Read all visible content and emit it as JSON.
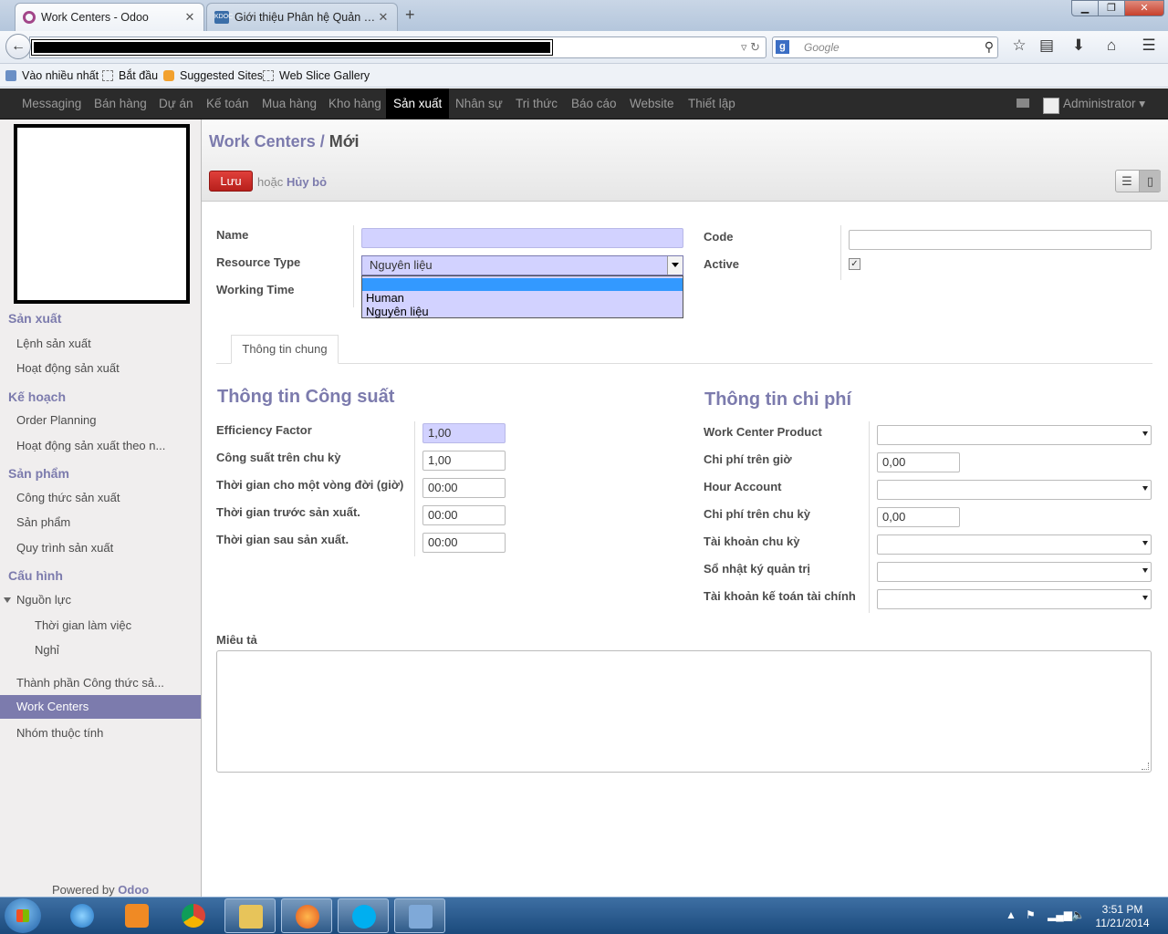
{
  "browser": {
    "tabs": [
      {
        "label": "Work Centers - Odoo",
        "active": true
      },
      {
        "label": "Giới thiệu Phân hệ Quản lý...",
        "active": false
      }
    ],
    "search_placeholder": "Google",
    "bookmarks": [
      "Vào nhiều nhất",
      "Bắt đầu",
      "Suggested Sites",
      "Web Slice Gallery"
    ]
  },
  "topmenu": {
    "items": [
      "Messaging",
      "Bán hàng",
      "Dự án",
      "Kế toán",
      "Mua hàng",
      "Kho hàng",
      "Sản xuất",
      "Nhân sự",
      "Tri thức",
      "Báo cáo",
      "Website",
      "Thiết lập"
    ],
    "active_index": 6,
    "user": "Administrator"
  },
  "sidebar": {
    "sections": [
      {
        "title": "Sản xuất",
        "items": [
          "Lệnh sản xuất",
          "Hoạt động sản xuất"
        ]
      },
      {
        "title": "Kế hoạch",
        "items": [
          "Order Planning",
          "Hoạt động sản xuất theo n..."
        ]
      },
      {
        "title": "Sản phẩm",
        "items": [
          "Công thức sản xuất",
          "Sản phẩm",
          "Quy trình sản xuất"
        ]
      },
      {
        "title": "Cấu hình",
        "items": [
          "Nguồn lực",
          "Thời gian làm việc",
          "Nghỉ",
          "Thành phần Công thức sả...",
          "Work Centers",
          "Nhóm thuộc tính"
        ]
      }
    ],
    "selected": "Work Centers",
    "powered_by": "Powered by",
    "powered_brand": "Odoo"
  },
  "header": {
    "breadcrumb_link": "Work Centers",
    "breadcrumb_sep": "/",
    "breadcrumb_current": "Mới",
    "save_label": "Lưu",
    "or_label": "hoặc",
    "discard_label": "Hủy bỏ"
  },
  "form": {
    "name_label": "Name",
    "name_value": "",
    "resource_type_label": "Resource Type",
    "resource_type_value": "Nguyên liệu",
    "resource_type_options": [
      "",
      "Human",
      "Nguyên liệu"
    ],
    "working_time_label": "Working Time",
    "code_label": "Code",
    "code_value": "",
    "active_label": "Active",
    "active_checked": true,
    "tab_label": "Thông tin chung",
    "capacity": {
      "title": "Thông tin Công suất",
      "rows": [
        {
          "label": "Efficiency Factor",
          "value": "1,00",
          "required": true
        },
        {
          "label": "Công suất trên chu kỳ",
          "value": "1,00"
        },
        {
          "label": "Thời gian cho một vòng đời (giờ)",
          "value": "00:00"
        },
        {
          "label": "Thời gian trước sản xuất.",
          "value": "00:00"
        },
        {
          "label": "Thời gian sau sản xuất.",
          "value": "00:00"
        }
      ]
    },
    "costing": {
      "title": "Thông tin chi phí",
      "rows": [
        {
          "label": "Work Center Product",
          "value": "",
          "type": "select"
        },
        {
          "label": "Chi phí trên giờ",
          "value": "0,00",
          "type": "input"
        },
        {
          "label": "Hour Account",
          "value": "",
          "type": "select"
        },
        {
          "label": "Chi phí trên chu kỳ",
          "value": "0,00",
          "type": "input"
        },
        {
          "label": "Tài khoản chu kỳ",
          "value": "",
          "type": "select"
        },
        {
          "label": "Sổ nhật ký quản trị",
          "value": "",
          "type": "select"
        },
        {
          "label": "Tài khoản kế toán tài chính",
          "value": "",
          "type": "select"
        }
      ]
    },
    "description_label": "Miêu tả",
    "description_value": ""
  },
  "taskbar": {
    "time": "3:51 PM",
    "date": "11/21/2014"
  }
}
